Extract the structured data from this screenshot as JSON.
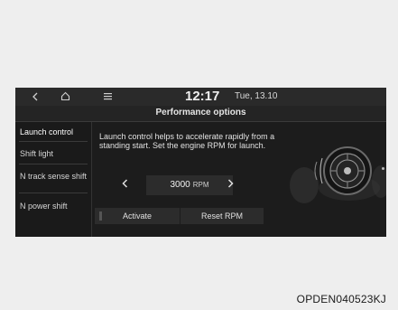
{
  "statusbar": {
    "back_icon": "chevron-left-icon",
    "home_icon": "home-icon",
    "menu_icon": "menu-icon",
    "time": "12:17",
    "date": "Tue, 13.10"
  },
  "header": {
    "title": "Performance options"
  },
  "sidebar": {
    "items": [
      {
        "label": "Launch control",
        "active": true
      },
      {
        "label": "Shift light",
        "active": false
      },
      {
        "label": "N track sense shift",
        "active": false
      },
      {
        "label": "N power shift",
        "active": false
      }
    ]
  },
  "main": {
    "description": "Launch control helps to accelerate rapidly from a standing start. Set the engine RPM for launch.",
    "rpm": {
      "value": "3000",
      "unit": "RPM"
    },
    "buttons": {
      "activate": "Activate",
      "reset": "Reset RPM"
    }
  },
  "footer": {
    "code": "OPDEN040523KJ"
  },
  "colors": {
    "screen_bg": "#1c1c1c",
    "text": "#e0e0e0",
    "page_bg": "#eeeeee"
  }
}
